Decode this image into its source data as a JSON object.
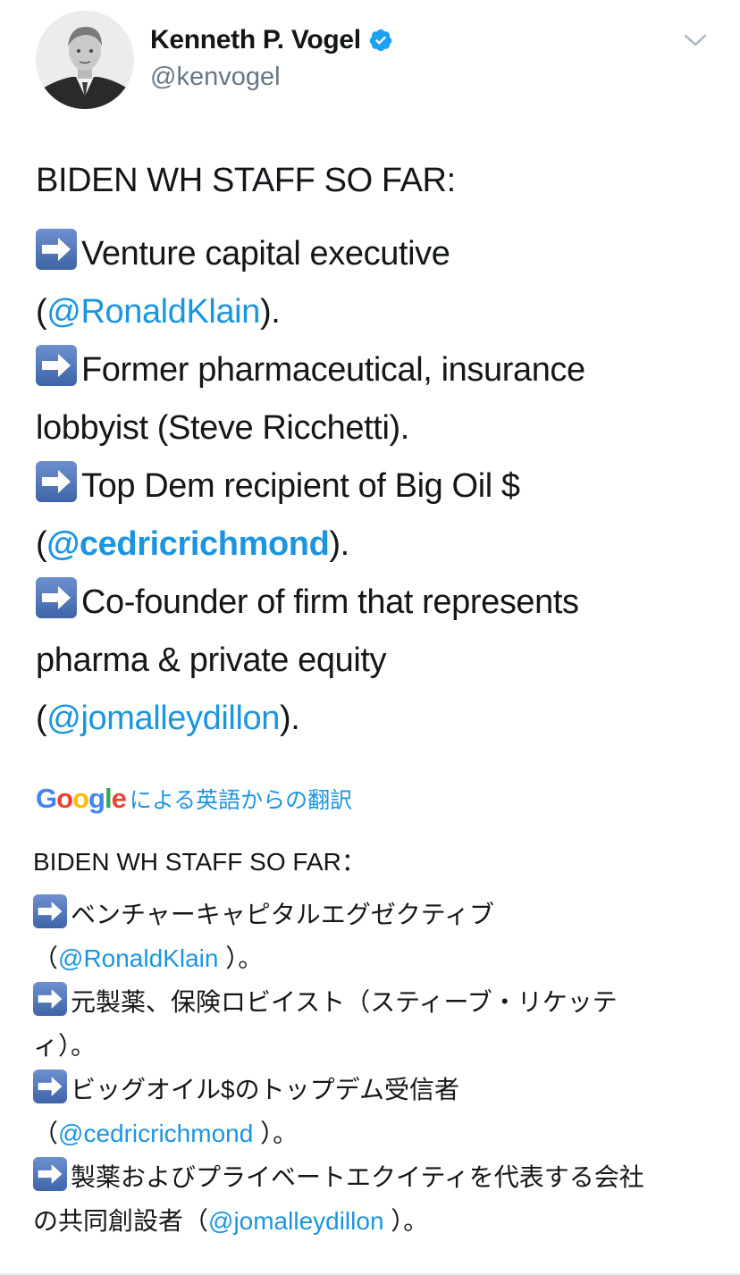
{
  "author": {
    "name": "Kenneth P. Vogel",
    "handle": "@kenvogel",
    "avatar_icon": "person-photo",
    "verified_icon": "verified-badge-icon"
  },
  "menu_icon": "chevron-down-icon",
  "tweet": {
    "title": "BIDEN WH STAFF SO FAR:",
    "items": [
      {
        "text": "Venture capital executive",
        "line2_pre": "(",
        "mention": "@RonaldKlain",
        "line2_post": ")."
      },
      {
        "text": "Former pharmaceutical, insurance",
        "line2": "lobbyist (Steve Ricchetti)."
      },
      {
        "text": "Top Dem recipient of Big Oil $",
        "line2_pre": "(",
        "mention": "@cedricrichmond",
        "line2_post": ")."
      },
      {
        "text": "Co-founder of firm that represents",
        "line2": "pharma & private equity",
        "line3_pre": "(",
        "mention": "@jomalleydillon",
        "line3_post": ")."
      }
    ]
  },
  "translation": {
    "brand": "Google",
    "label": "による英語からの翻訳",
    "title": "BIDEN WH STAFF SO FAR：",
    "item1_text": "ベンチャーキャピタルエグゼクティブ",
    "item1_pre": "（",
    "item1_mention": "@RonaldKlain",
    "item1_post": " ）。",
    "item2_text": "元製薬、保険ロビイスト（スティーブ・リケッテ",
    "item2_line2": "ィ）。",
    "item3_text": "ビッグオイル$のトップデム受信者",
    "item3_pre": "（",
    "item3_mention": "@cedricrichmond",
    "item3_post": " ）。",
    "item4_text": "製薬およびプライベートエクイティを代表する会社",
    "item4_line2_pre": "の共同創設者（",
    "item4_mention": "@jomalleydillon",
    "item4_post": " ）。"
  },
  "colors": {
    "link": "#1b95e0",
    "text": "#14171a",
    "secondary": "#657786",
    "arrow_emoji": "#4a6da8"
  }
}
